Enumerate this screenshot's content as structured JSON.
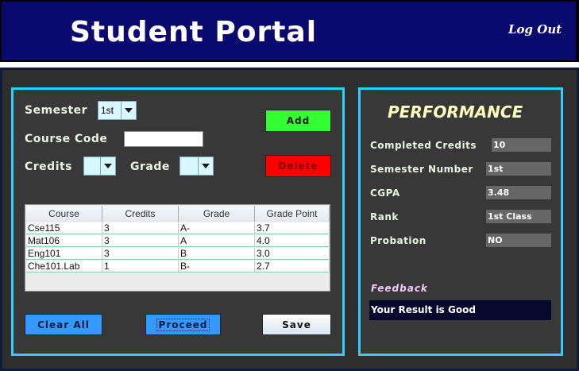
{
  "header": {
    "title": "Student Portal",
    "logout_label": "Log Out"
  },
  "form": {
    "semester_label": "Semester",
    "semester_value": "1st",
    "course_code_label": "Course Code",
    "course_code_value": "",
    "credits_label": "Credits",
    "credits_value": "",
    "grade_label": "Grade",
    "grade_value": ""
  },
  "buttons": {
    "add": "Add",
    "delete": "Delete",
    "clear_all": "Clear All",
    "proceed": "Proceed",
    "save": "Save"
  },
  "table": {
    "columns": [
      "Course",
      "Credits",
      "Grade",
      "Grade Point"
    ],
    "rows": [
      [
        "Cse115",
        "3",
        "A-",
        "3.7"
      ],
      [
        "Mat106",
        "3",
        "A",
        "4.0"
      ],
      [
        "Eng101",
        "3",
        "B",
        "3.0"
      ],
      [
        "Che101.Lab",
        "1",
        "B-",
        "2.7"
      ]
    ]
  },
  "performance": {
    "title": "PERFORMANCE",
    "completed_credits_label": "Completed Credits",
    "completed_credits_value": "10",
    "semester_number_label": "Semester Number",
    "semester_number_value": "1st",
    "cgpa_label": "CGPA",
    "cgpa_value": "3.48",
    "rank_label": "Rank",
    "rank_value": "1st Class",
    "probation_label": "Probation",
    "probation_value": "NO",
    "feedback_label": "Feedback",
    "feedback_value": "Your Result is Good"
  },
  "colors": {
    "header_bg": "#0a0a6e",
    "panel_border": "#33ccff",
    "add_button": "#33ff33",
    "delete_button": "#ff0000",
    "blue_button": "#3399ff"
  }
}
